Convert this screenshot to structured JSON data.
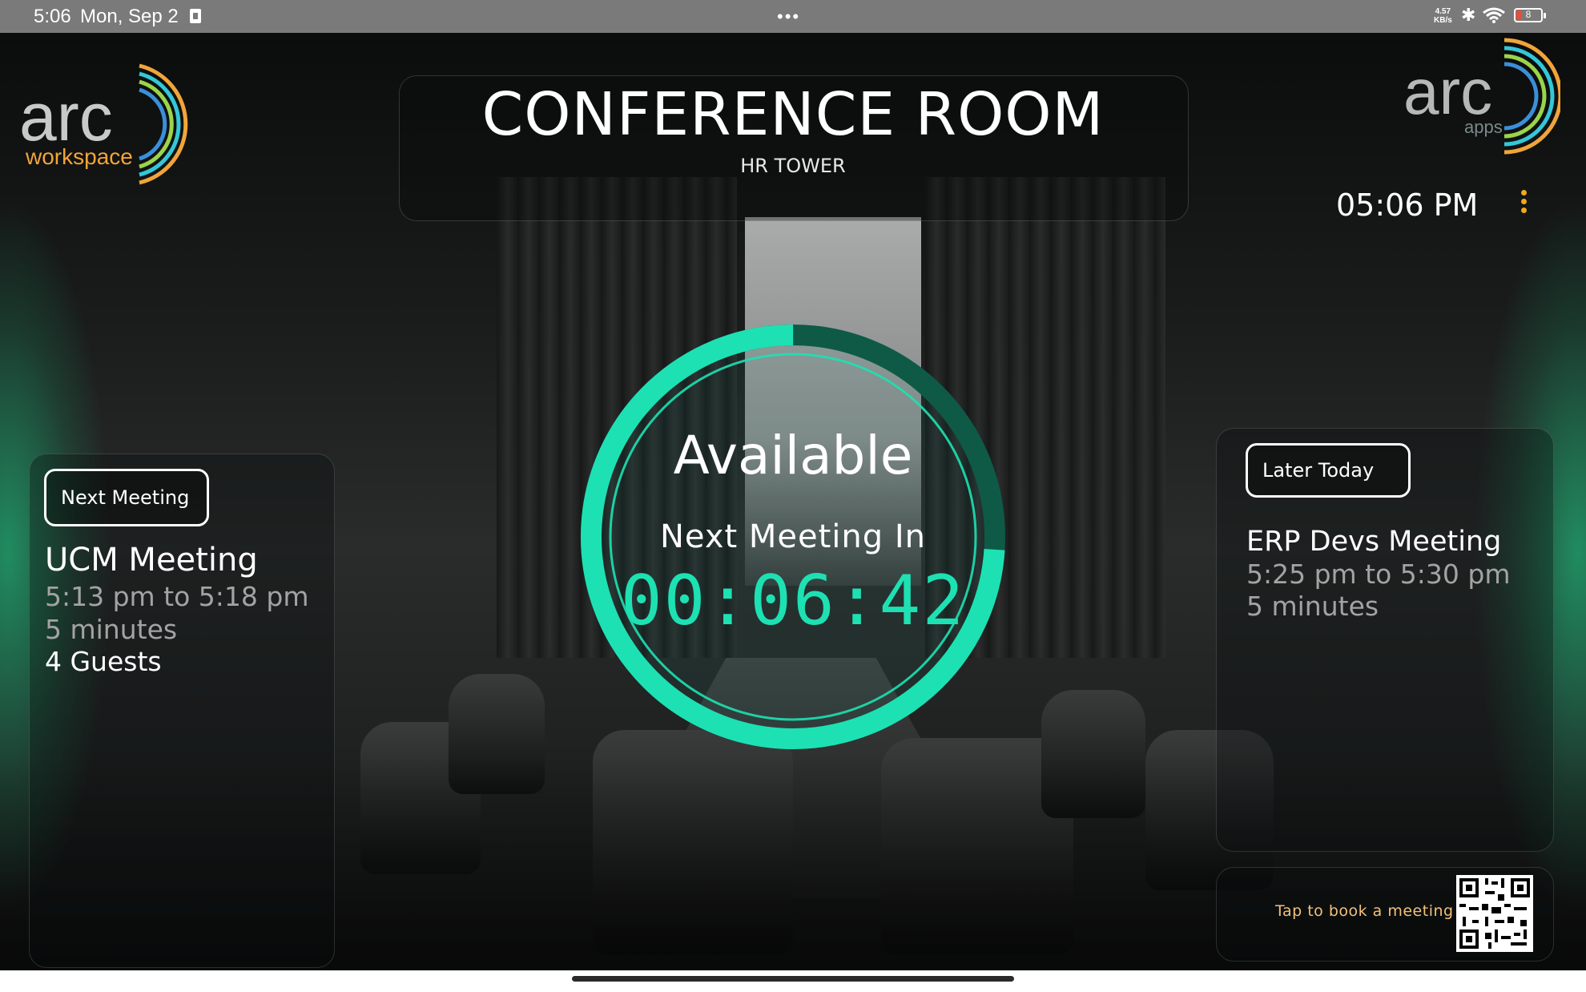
{
  "status_bar": {
    "time": "5:06",
    "date": "Mon, Sep 2",
    "more_dots": "•••",
    "net_speed_value": "4.57",
    "net_speed_unit": "KB/s",
    "battery_level": "8"
  },
  "header": {
    "room_name": "CONFERENCE ROOM",
    "building": "HR TOWER",
    "clock": "05:06 PM"
  },
  "logos": {
    "left_word": "arc",
    "left_sub": "workspace",
    "right_word": "arc",
    "right_sub": "apps"
  },
  "status": {
    "label": "Available",
    "next_meeting_in_label": "Next Meeting In",
    "countdown": "00:06:42",
    "progress_fraction": 0.74,
    "accent_color": "#1de1b3"
  },
  "next_meeting": {
    "tab_label": "Next Meeting",
    "title": "UCM Meeting",
    "time_range": "5:13 pm to 5:18 pm",
    "duration": "5 minutes",
    "guests": "4 Guests"
  },
  "later_today": {
    "tab_label": "Later Today",
    "meetings": [
      {
        "title": "ERP Devs Meeting",
        "time_range": "5:25 pm to 5:30 pm",
        "duration": "5 minutes"
      }
    ]
  },
  "booking": {
    "prompt": "Tap to book a meeting",
    "qr_icon": "qr-code-icon"
  },
  "colors": {
    "brand_green": "#18dc8c",
    "menu_dots": "#f0a91a",
    "book_text": "#f3c07a"
  }
}
